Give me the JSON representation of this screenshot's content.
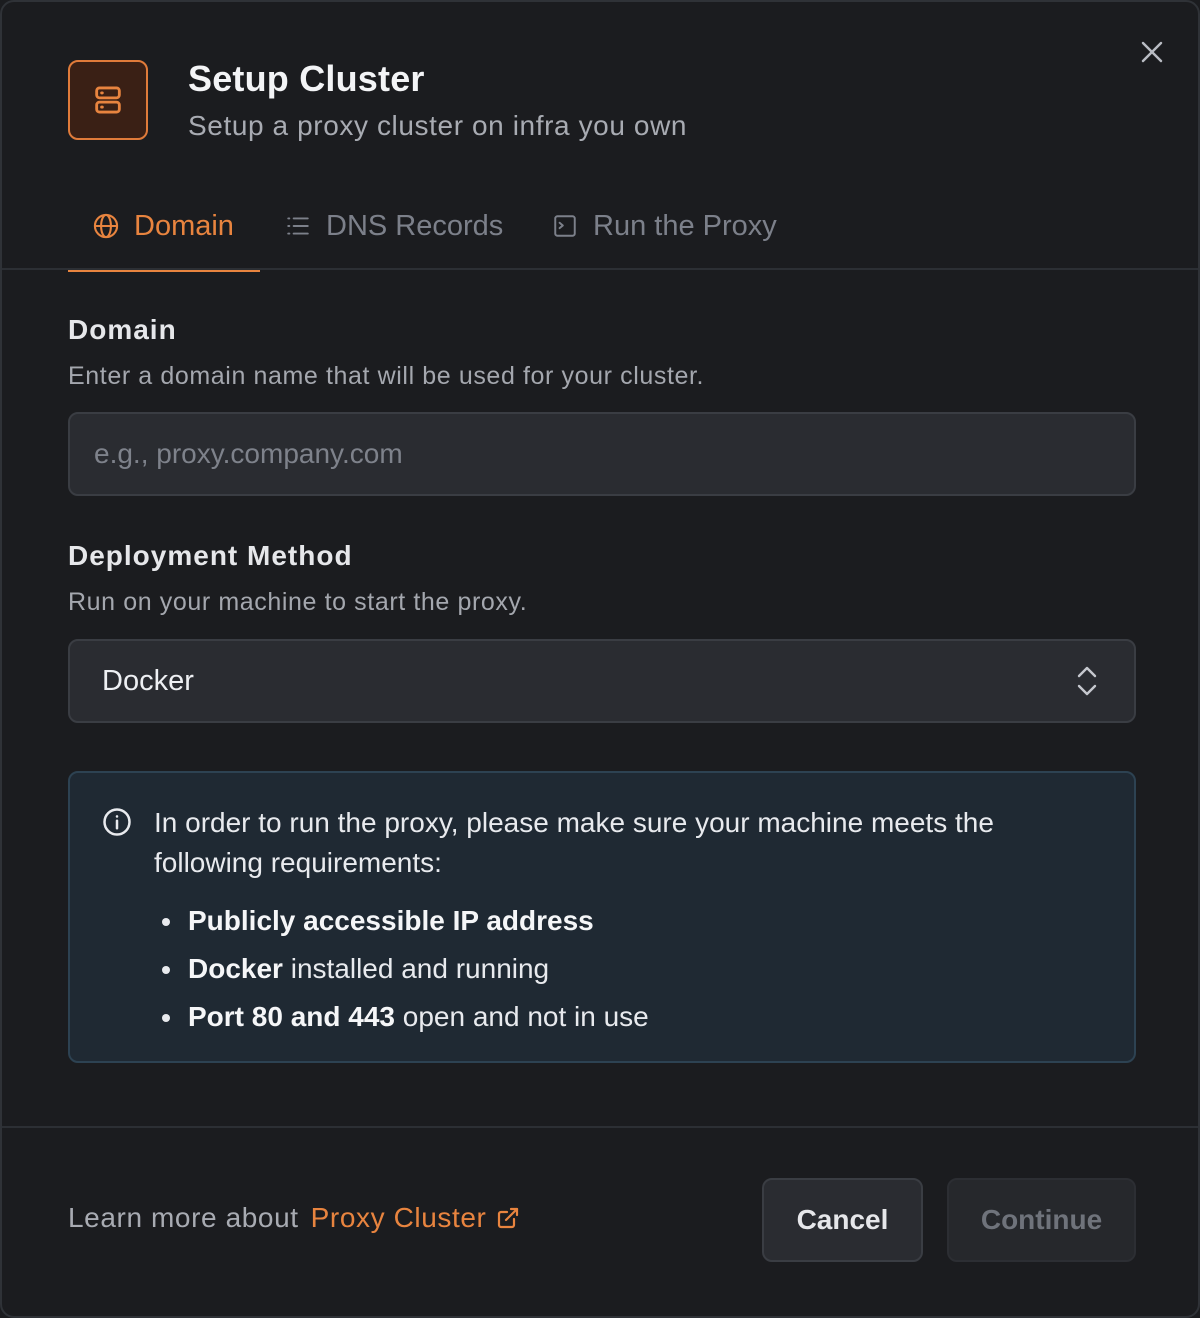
{
  "dialog": {
    "title": "Setup Cluster",
    "subtitle": "Setup a proxy cluster on infra you own",
    "header_icon": "server-stack-icon",
    "accent_color": "#e8843f"
  },
  "tabs": [
    {
      "label": "Domain",
      "icon": "globe-icon",
      "active": true
    },
    {
      "label": "DNS Records",
      "icon": "list-icon",
      "active": false
    },
    {
      "label": "Run the Proxy",
      "icon": "terminal-icon",
      "active": false
    }
  ],
  "domain_section": {
    "label": "Domain",
    "help": "Enter a domain name that will be used for your cluster.",
    "placeholder": "e.g., proxy.company.com",
    "value": ""
  },
  "deployment_section": {
    "label": "Deployment Method",
    "help": "Run on your machine to start the proxy.",
    "selected": "Docker"
  },
  "info": {
    "intro": "In order to run the proxy, please make sure your machine meets the following requirements:",
    "requirements": [
      {
        "bold": "Publicly accessible IP address",
        "rest": ""
      },
      {
        "bold": "Docker",
        "rest": " installed and running"
      },
      {
        "bold": "Port 80 and 443",
        "rest": " open and not in use"
      }
    ]
  },
  "footer": {
    "learn_prefix": "Learn more about",
    "learn_link": "Proxy Cluster",
    "cancel_label": "Cancel",
    "continue_label": "Continue"
  }
}
